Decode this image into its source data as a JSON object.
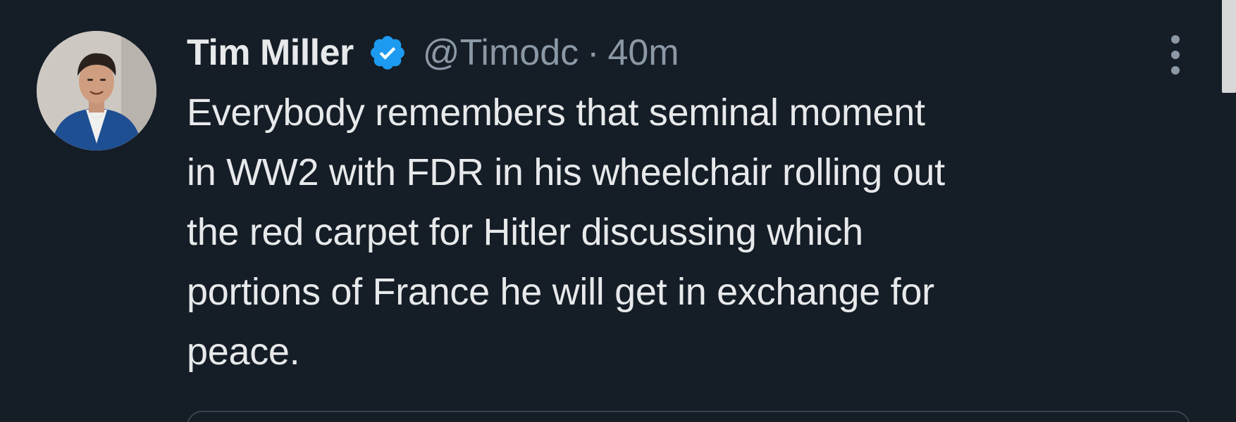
{
  "tweet": {
    "display_name": "Tim Miller",
    "handle": "@Timodc",
    "separator": "·",
    "time": "40m",
    "verified": true,
    "text": "Everybody remembers that seminal moment\nin WW2 with FDR in his wheelchair rolling out\nthe red carpet for Hitler discussing which\nportions of France he will get in exchange for\npeace."
  },
  "icons": {
    "verified": "verified-badge-icon",
    "more": "more-vertical-icon",
    "avatar": "profile-photo"
  },
  "colors": {
    "background": "#151d27",
    "text_primary": "#e7e9ea",
    "text_secondary": "#8b98a5",
    "verified_blue": "#1d9bf0"
  }
}
